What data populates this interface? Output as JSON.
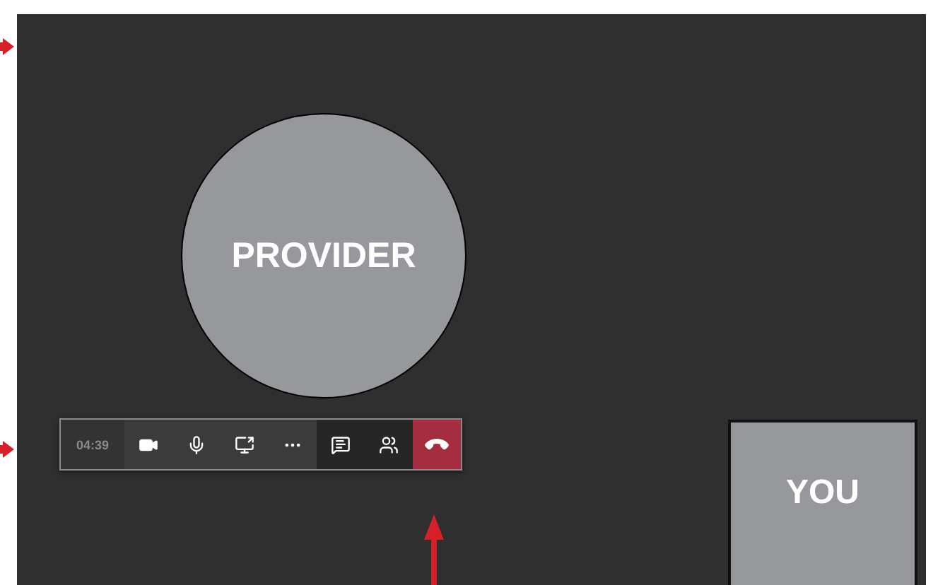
{
  "participant": {
    "label": "PROVIDER"
  },
  "self_view": {
    "label": "YOU"
  },
  "call_toolbar": {
    "timer": "04:39",
    "buttons": [
      {
        "kind": "camera",
        "color": "#3b3b3b"
      },
      {
        "kind": "mic",
        "color": "#3b3b3b"
      },
      {
        "kind": "share",
        "color": "#3b3b3b"
      },
      {
        "kind": "more",
        "color": "#3b3b3b"
      },
      {
        "kind": "chat",
        "color": "#262626"
      },
      {
        "kind": "people",
        "color": "#262626"
      },
      {
        "kind": "hangup",
        "color": "#a52d40"
      }
    ]
  }
}
